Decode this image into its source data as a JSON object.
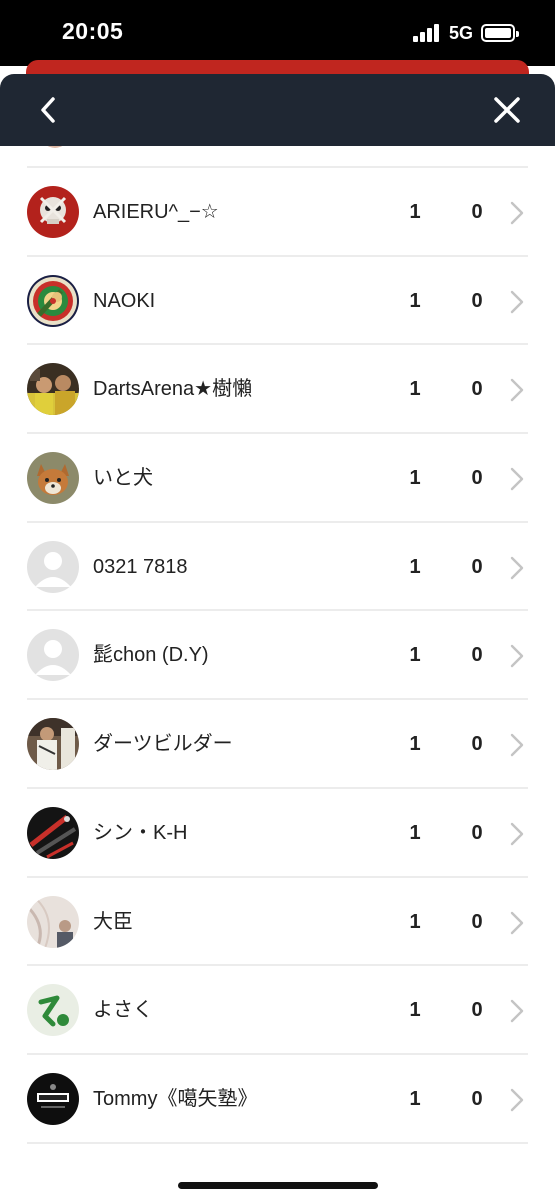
{
  "status_bar": {
    "time": "20:05",
    "network": "5G"
  },
  "header": {
    "back_icon": "chevron-left-icon",
    "close_icon": "close-icon"
  },
  "players": [
    {
      "name": "ARIERU^_−☆",
      "stat1": "1",
      "stat2": "0",
      "avatar": "avatar-red-skull"
    },
    {
      "name": "NAOKI",
      "stat1": "1",
      "stat2": "0",
      "avatar": "avatar-dartboard"
    },
    {
      "name": "DartsArena★樹懶",
      "stat1": "1",
      "stat2": "0",
      "avatar": "avatar-photo-group"
    },
    {
      "name": "いと犬",
      "stat1": "1",
      "stat2": "0",
      "avatar": "avatar-fox"
    },
    {
      "name": "0321 7818",
      "stat1": "1",
      "stat2": "0",
      "avatar": "avatar-default"
    },
    {
      "name": "髭chon (D.Y)",
      "stat1": "1",
      "stat2": "0",
      "avatar": "avatar-default"
    },
    {
      "name": "ダーツビルダー",
      "stat1": "1",
      "stat2": "0",
      "avatar": "avatar-photo-person"
    },
    {
      "name": "シン・K-H",
      "stat1": "1",
      "stat2": "0",
      "avatar": "avatar-darts"
    },
    {
      "name": "大臣",
      "stat1": "1",
      "stat2": "0",
      "avatar": "avatar-photo-light"
    },
    {
      "name": "よさく",
      "stat1": "1",
      "stat2": "0",
      "avatar": "avatar-green-logo"
    },
    {
      "name": "Tommy《噶矢塾》",
      "stat1": "1",
      "stat2": "0",
      "avatar": "avatar-black-logo"
    }
  ],
  "colors": {
    "header_bg": "#1f2733",
    "accent_red": "#c0261f",
    "divider": "#ececec",
    "chevron": "#c4c4c4"
  }
}
